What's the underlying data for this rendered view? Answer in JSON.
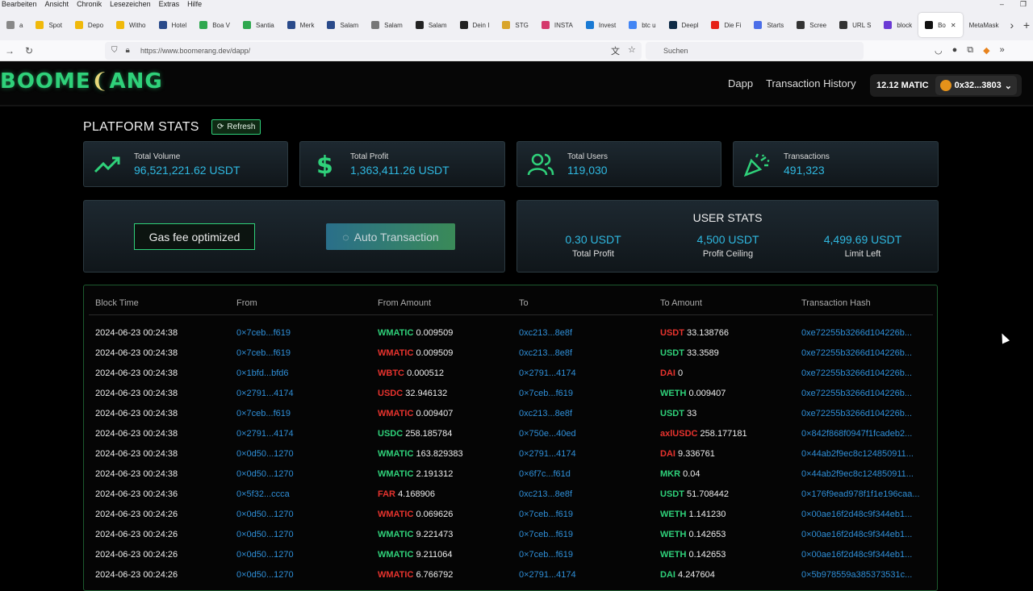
{
  "browser": {
    "menu": [
      "Bearbeiten",
      "Ansicht",
      "Chronik",
      "Lesezeichen",
      "Extras",
      "Hilfe"
    ],
    "tabs": [
      {
        "label": "a",
        "icon": "partial-tab",
        "color": "#888"
      },
      {
        "label": "Spot",
        "icon": "binance-icon",
        "color": "#f0b90b"
      },
      {
        "label": "Depo",
        "icon": "binance-icon",
        "color": "#f0b90b"
      },
      {
        "label": "Witho",
        "icon": "binance-icon",
        "color": "#f0b90b"
      },
      {
        "label": "Hotel",
        "icon": "page-icon",
        "color": "#2a4a8a"
      },
      {
        "label": "Boa V",
        "icon": "map-pin-icon",
        "color": "#2fa84f"
      },
      {
        "label": "Santia",
        "icon": "map-pin-icon",
        "color": "#2fa84f"
      },
      {
        "label": "Merk",
        "icon": "page-icon",
        "color": "#2a4a8a"
      },
      {
        "label": "Salam",
        "icon": "page-icon",
        "color": "#2a4a8a"
      },
      {
        "label": "Salam",
        "icon": "wave-icon",
        "color": "#777"
      },
      {
        "label": "Salam",
        "icon": "wikipedia-icon",
        "color": "#222"
      },
      {
        "label": "Dein I",
        "icon": "page-icon",
        "color": "#222"
      },
      {
        "label": "STG",
        "icon": "stg-icon",
        "color": "#d9a52a"
      },
      {
        "label": "INSTA",
        "icon": "insta-icon",
        "color": "#d4386b"
      },
      {
        "label": "Invest",
        "icon": "page-icon",
        "color": "#1a7ad4"
      },
      {
        "label": "btc u",
        "icon": "google-icon",
        "color": "#4285f4"
      },
      {
        "label": "Deepl",
        "icon": "deepl-icon",
        "color": "#0f2b46"
      },
      {
        "label": "Die Fi",
        "icon": "youtube-icon",
        "color": "#e62117"
      },
      {
        "label": "Starts",
        "icon": "startpage-icon",
        "color": "#4b6ee8"
      },
      {
        "label": "Scree",
        "icon": "screen-icon",
        "color": "#333"
      },
      {
        "label": "URL S",
        "icon": "link-icon",
        "color": "#333"
      },
      {
        "label": "block",
        "icon": "cube-icon",
        "color": "#6a3ad4"
      },
      {
        "label": "Bo",
        "icon": "boomerang-icon",
        "color": "#111",
        "active": true
      },
      {
        "label": "MetaMask",
        "icon": "",
        "color": ""
      }
    ],
    "url": "https://www.boomerang.dev/dapp/",
    "search_placeholder": "Suchen"
  },
  "site": {
    "logo": {
      "part1": "BOOME",
      "part2": "ANG"
    },
    "nav": [
      "Dapp",
      "Transaction History"
    ],
    "wallet": {
      "balance": "12.12 MATIC",
      "address": "0x32...3803"
    }
  },
  "stats": {
    "title": "PLATFORM STATS",
    "refresh_label": "Refresh",
    "cards": [
      {
        "label": "Total Volume",
        "value": "96,521,221.62 USDT",
        "icon": "trending-up-icon"
      },
      {
        "label": "Total Profit",
        "value": "1,363,411.26 USDT",
        "icon": "dollar-icon"
      },
      {
        "label": "Total Users",
        "value": "119,030",
        "icon": "users-icon"
      },
      {
        "label": "Transactions",
        "value": "491,323",
        "icon": "party-popper-icon"
      }
    ]
  },
  "actions": {
    "gas": "Gas fee optimized",
    "auto": "Auto Transaction"
  },
  "user_stats": {
    "title": "USER STATS",
    "items": [
      {
        "value": "0.30 USDT",
        "label": "Total Profit"
      },
      {
        "value": "4,500 USDT",
        "label": "Profit Ceiling"
      },
      {
        "value": "4,499.69 USDT",
        "label": "Limit Left"
      }
    ]
  },
  "colors": {
    "green": "#2fd17a",
    "red": "#e8332e",
    "blue": "#2f8fd8",
    "cyan": "#2fb8e0"
  },
  "table": {
    "headers": [
      "Block Time",
      "From",
      "From Amount",
      "To",
      "To Amount",
      "Transaction Hash"
    ],
    "rows": [
      {
        "time": "2024-06-23 00:24:38",
        "from": "0×7ceb...f619",
        "ftok": "WMATIC",
        "famt": "0.009509",
        "fcol": "green",
        "to": "0xc213...8e8f",
        "ttok": "USDT",
        "tamt": "33.138766",
        "tcol": "red",
        "hash": "0xe72255b3266d104226b..."
      },
      {
        "time": "2024-06-23 00:24:38",
        "from": "0×7ceb...f619",
        "ftok": "WMATIC",
        "famt": "0.009509",
        "fcol": "red",
        "to": "0xc213...8e8f",
        "ttok": "USDT",
        "tamt": "33.3589",
        "tcol": "green",
        "hash": "0xe72255b3266d104226b..."
      },
      {
        "time": "2024-06-23 00:24:38",
        "from": "0×1bfd...bfd6",
        "ftok": "WBTC",
        "famt": "0.000512",
        "fcol": "red",
        "to": "0×2791...4174",
        "ttok": "DAI",
        "tamt": "0",
        "tcol": "red",
        "hash": "0xe72255b3266d104226b..."
      },
      {
        "time": "2024-06-23 00:24:38",
        "from": "0×2791...4174",
        "ftok": "USDC",
        "famt": "32.946132",
        "fcol": "red",
        "to": "0×7ceb...f619",
        "ttok": "WETH",
        "tamt": "0.009407",
        "tcol": "green",
        "hash": "0xe72255b3266d104226b..."
      },
      {
        "time": "2024-06-23 00:24:38",
        "from": "0×7ceb...f619",
        "ftok": "WMATIC",
        "famt": "0.009407",
        "fcol": "red",
        "to": "0xc213...8e8f",
        "ttok": "USDT",
        "tamt": "33",
        "tcol": "green",
        "hash": "0xe72255b3266d104226b..."
      },
      {
        "time": "2024-06-23 00:24:38",
        "from": "0×2791...4174",
        "ftok": "USDC",
        "famt": "258.185784",
        "fcol": "green",
        "to": "0×750e...40ed",
        "ttok": "axlUSDC",
        "tamt": "258.177181",
        "tcol": "red",
        "hash": "0×842f868f0947f1fcadeb2..."
      },
      {
        "time": "2024-06-23 00:24:38",
        "from": "0×0d50...1270",
        "ftok": "WMATIC",
        "famt": "163.829383",
        "fcol": "green",
        "to": "0×2791...4174",
        "ttok": "DAI",
        "tamt": "9.336761",
        "tcol": "red",
        "hash": "0×44ab2f9ec8c124850911..."
      },
      {
        "time": "2024-06-23 00:24:38",
        "from": "0×0d50...1270",
        "ftok": "WMATIC",
        "famt": "2.191312",
        "fcol": "green",
        "to": "0×6f7c...f61d",
        "ttok": "MKR",
        "tamt": "0.04",
        "tcol": "green",
        "hash": "0×44ab2f9ec8c124850911..."
      },
      {
        "time": "2024-06-23 00:24:36",
        "from": "0×5f32...ccca",
        "ftok": "FAR",
        "famt": "4.168906",
        "fcol": "red",
        "to": "0xc213...8e8f",
        "ttok": "USDT",
        "tamt": "51.708442",
        "tcol": "green",
        "hash": "0×176f9ead978f1f1e196caa..."
      },
      {
        "time": "2024-06-23 00:24:26",
        "from": "0×0d50...1270",
        "ftok": "WMATIC",
        "famt": "0.069626",
        "fcol": "red",
        "to": "0×7ceb...f619",
        "ttok": "WETH",
        "tamt": "1.141230",
        "tcol": "green",
        "hash": "0×00ae16f2d48c9f344eb1..."
      },
      {
        "time": "2024-06-23 00:24:26",
        "from": "0×0d50...1270",
        "ftok": "WMATIC",
        "famt": "9.221473",
        "fcol": "green",
        "to": "0×7ceb...f619",
        "ttok": "WETH",
        "tamt": "0.142653",
        "tcol": "green",
        "hash": "0×00ae16f2d48c9f344eb1..."
      },
      {
        "time": "2024-06-23 00:24:26",
        "from": "0×0d50...1270",
        "ftok": "WMATIC",
        "famt": "9.211064",
        "fcol": "green",
        "to": "0×7ceb...f619",
        "ttok": "WETH",
        "tamt": "0.142653",
        "tcol": "green",
        "hash": "0×00ae16f2d48c9f344eb1..."
      },
      {
        "time": "2024-06-23 00:24:26",
        "from": "0×0d50...1270",
        "ftok": "WMATIC",
        "famt": "6.766792",
        "fcol": "red",
        "to": "0×2791...4174",
        "ttok": "DAI",
        "tamt": "4.247604",
        "tcol": "green",
        "hash": "0×5b978559a385373531c..."
      }
    ]
  }
}
